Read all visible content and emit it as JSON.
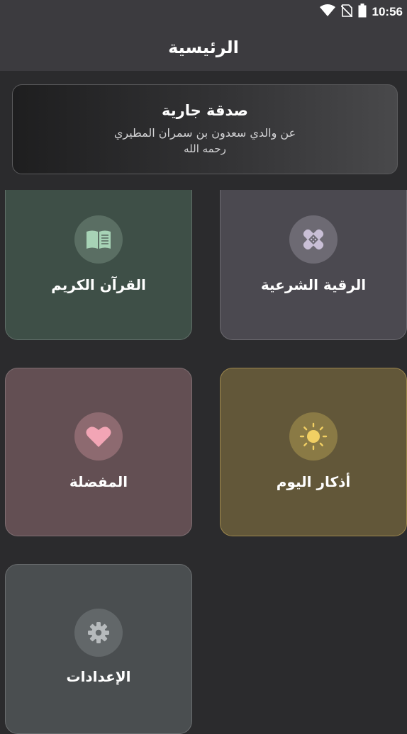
{
  "status_bar": {
    "time": "10:56",
    "icons": [
      "wifi-icon",
      "no-sim-icon",
      "battery-icon"
    ]
  },
  "app_bar": {
    "title": "الرئيسية"
  },
  "sadaqa_card": {
    "title": "صدقة جارية",
    "line1": "عن والدي سعدون بن سمران المطيري",
    "line2": "رحمه الله"
  },
  "tiles": [
    {
      "id": "ruqyah",
      "label": "الرقية الشرعية",
      "icon": "bandage-icon",
      "color": "#4b4950",
      "icon_color": "#c9bfd6"
    },
    {
      "id": "quran",
      "label": "القرآن الكريم",
      "icon": "book-icon",
      "color": "#3e4f47",
      "icon_color": "#a7d3b6"
    },
    {
      "id": "adhkar",
      "label": "أذكار اليوم",
      "icon": "sun-icon",
      "color": "#625739",
      "icon_color": "#f1cf63"
    },
    {
      "id": "favorites",
      "label": "المفضلة",
      "icon": "heart-icon",
      "color": "#634f53",
      "icon_color": "#f2a5b5"
    },
    {
      "id": "settings",
      "label": "الإعدادات",
      "icon": "gear-icon",
      "color": "#4a4e50",
      "icon_color": "#b6babc"
    }
  ]
}
